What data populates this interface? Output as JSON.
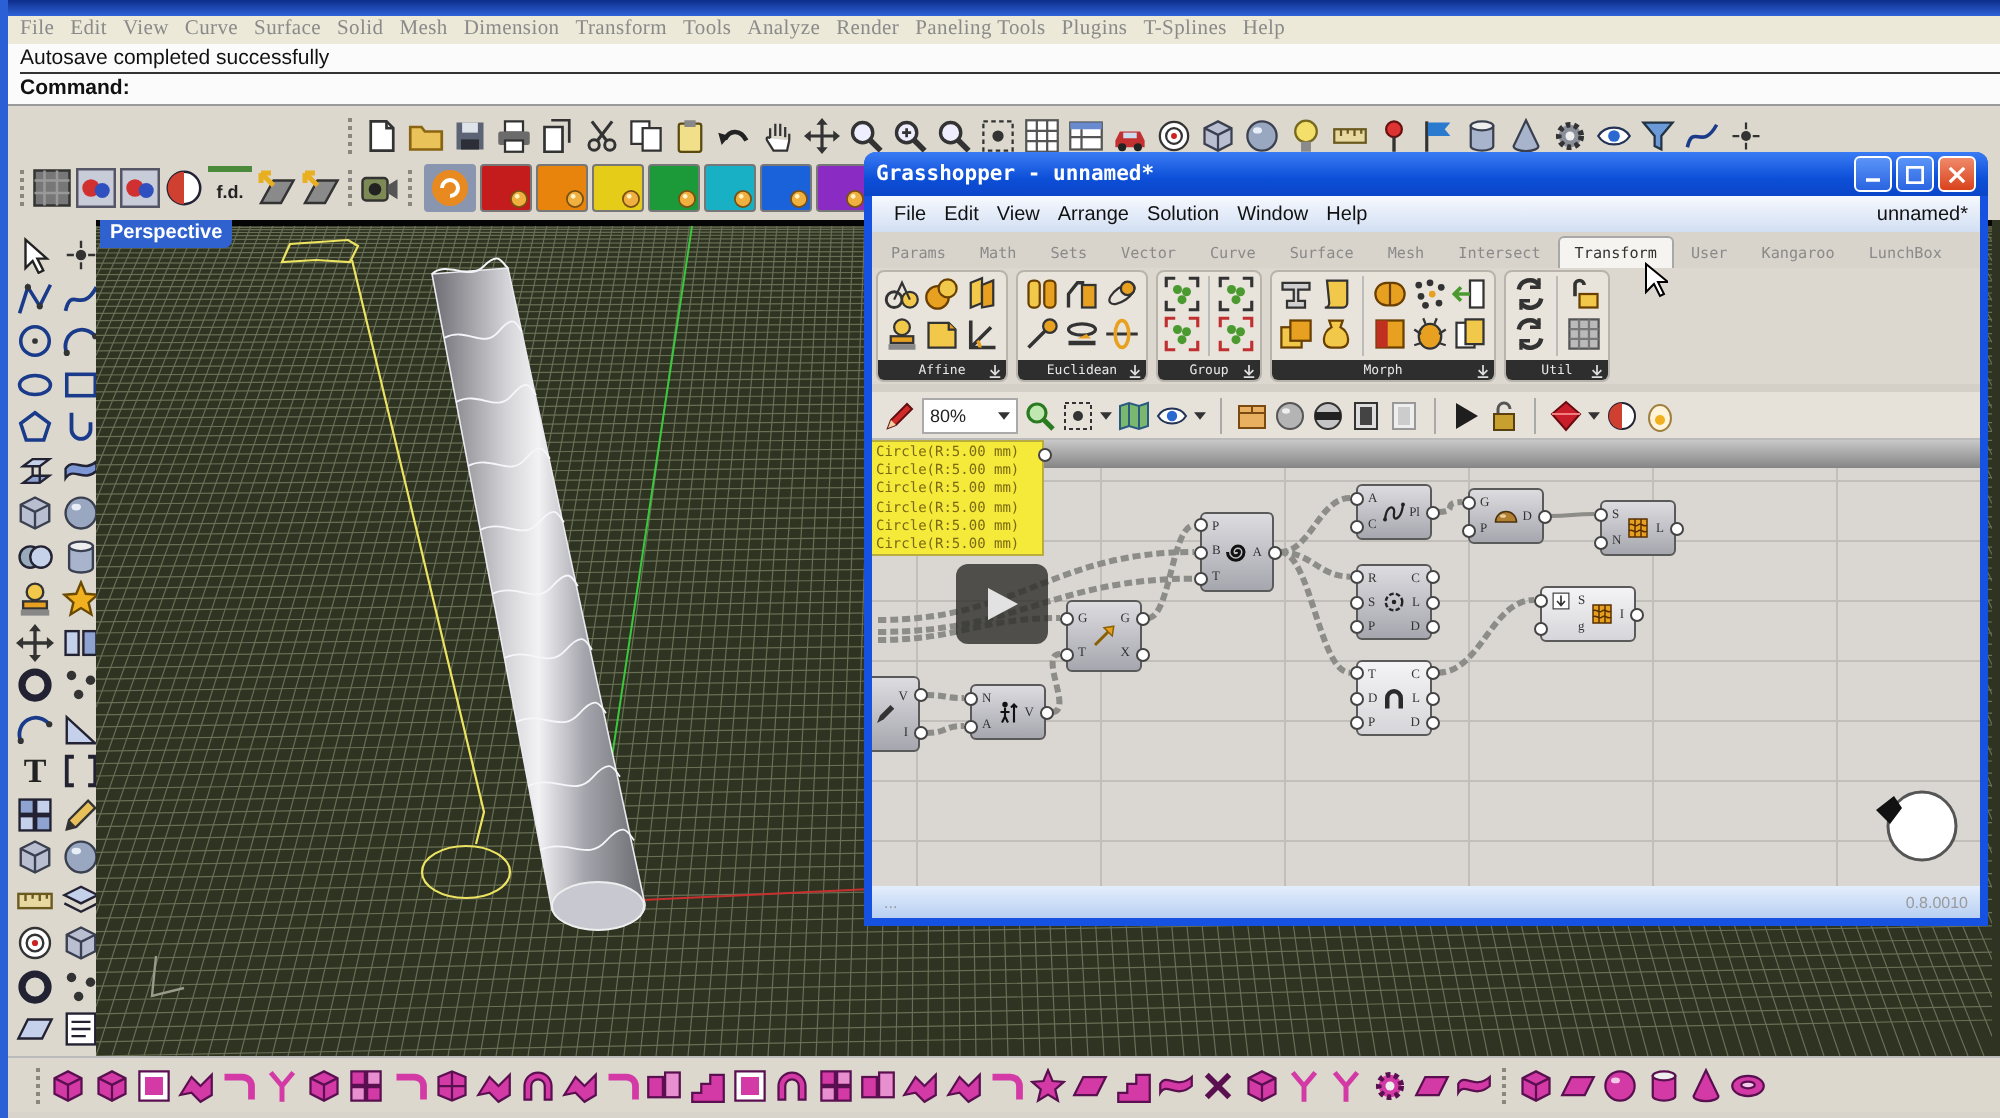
{
  "rhino": {
    "menu": [
      "File",
      "Edit",
      "View",
      "Curve",
      "Surface",
      "Solid",
      "Mesh",
      "Dimension",
      "Transform",
      "Tools",
      "Analyze",
      "Render",
      "Paneling Tools",
      "Plugins",
      "T-Splines",
      "Help"
    ],
    "command": {
      "history": "Autosave completed successfully",
      "prompt": "Command:"
    },
    "display_button": "f.d.",
    "color_buttons": [
      {
        "color": "#c41c1c"
      },
      {
        "color": "#e8840c"
      },
      {
        "color": "#e4cc18"
      },
      {
        "color": "#1c9a3a"
      },
      {
        "color": "#18b0c4"
      },
      {
        "color": "#1a62da"
      },
      {
        "color": "#8a2cc4"
      }
    ],
    "text_tool": "T",
    "viewport": {
      "title": "Perspective"
    }
  },
  "grasshopper": {
    "title": "Grasshopper - unnamed*",
    "menu": [
      "File",
      "Edit",
      "View",
      "Arrange",
      "Solution",
      "Window",
      "Help"
    ],
    "document": "unnamed*",
    "tabs": [
      {
        "label": "Params",
        "selected": false
      },
      {
        "label": "Math",
        "selected": false
      },
      {
        "label": "Sets",
        "selected": false
      },
      {
        "label": "Vector",
        "selected": false
      },
      {
        "label": "Curve",
        "selected": false
      },
      {
        "label": "Surface",
        "selected": false
      },
      {
        "label": "Mesh",
        "selected": false
      },
      {
        "label": "Intersect",
        "selected": false
      },
      {
        "label": "Transform",
        "selected": true
      },
      {
        "label": "User",
        "selected": false
      },
      {
        "label": "Kangaroo",
        "selected": false
      },
      {
        "label": "LunchBox",
        "selected": false
      }
    ],
    "ribbon_groups": [
      "Affine",
      "Euclidean",
      "Group",
      "Morph",
      "Util"
    ],
    "zoom": "80%",
    "panel": [
      "Circle(R:5.00 mm)",
      "Circle(R:5.00 mm)",
      "Circle(R:5.00 mm)",
      "Circle(R:5.00 mm)",
      "Circle(R:5.00 mm)",
      "Circle(R:5.00 mm)"
    ],
    "nodes": [
      {
        "inputs": [
          "A",
          "C"
        ],
        "outputs": [
          "Pl"
        ]
      },
      {
        "inputs": [
          "G",
          "P"
        ],
        "outputs": [
          "D"
        ]
      },
      {
        "inputs": [
          "S",
          "N"
        ],
        "outputs": [
          "L"
        ]
      },
      {
        "inputs": [
          "P",
          "B",
          "T"
        ],
        "outputs": [
          "A"
        ]
      },
      {
        "inputs": [
          "R",
          "S",
          "P"
        ],
        "outputs": [
          "C",
          "L",
          "D"
        ]
      },
      {
        "inputs": [
          "S",
          "g"
        ],
        "outputs": [
          "I"
        ]
      },
      {
        "inputs": [
          "G",
          "T"
        ],
        "outputs": [
          "G",
          "X"
        ]
      },
      {
        "inputs": [
          "T",
          "D",
          "P"
        ],
        "outputs": [
          "C",
          "L",
          "D"
        ]
      },
      {
        "outputs": [
          "V",
          "I"
        ]
      },
      {
        "inputs": [
          "N",
          "A"
        ],
        "outputs": [
          "V"
        ]
      }
    ],
    "status": "...",
    "version": "0.8.0010"
  }
}
